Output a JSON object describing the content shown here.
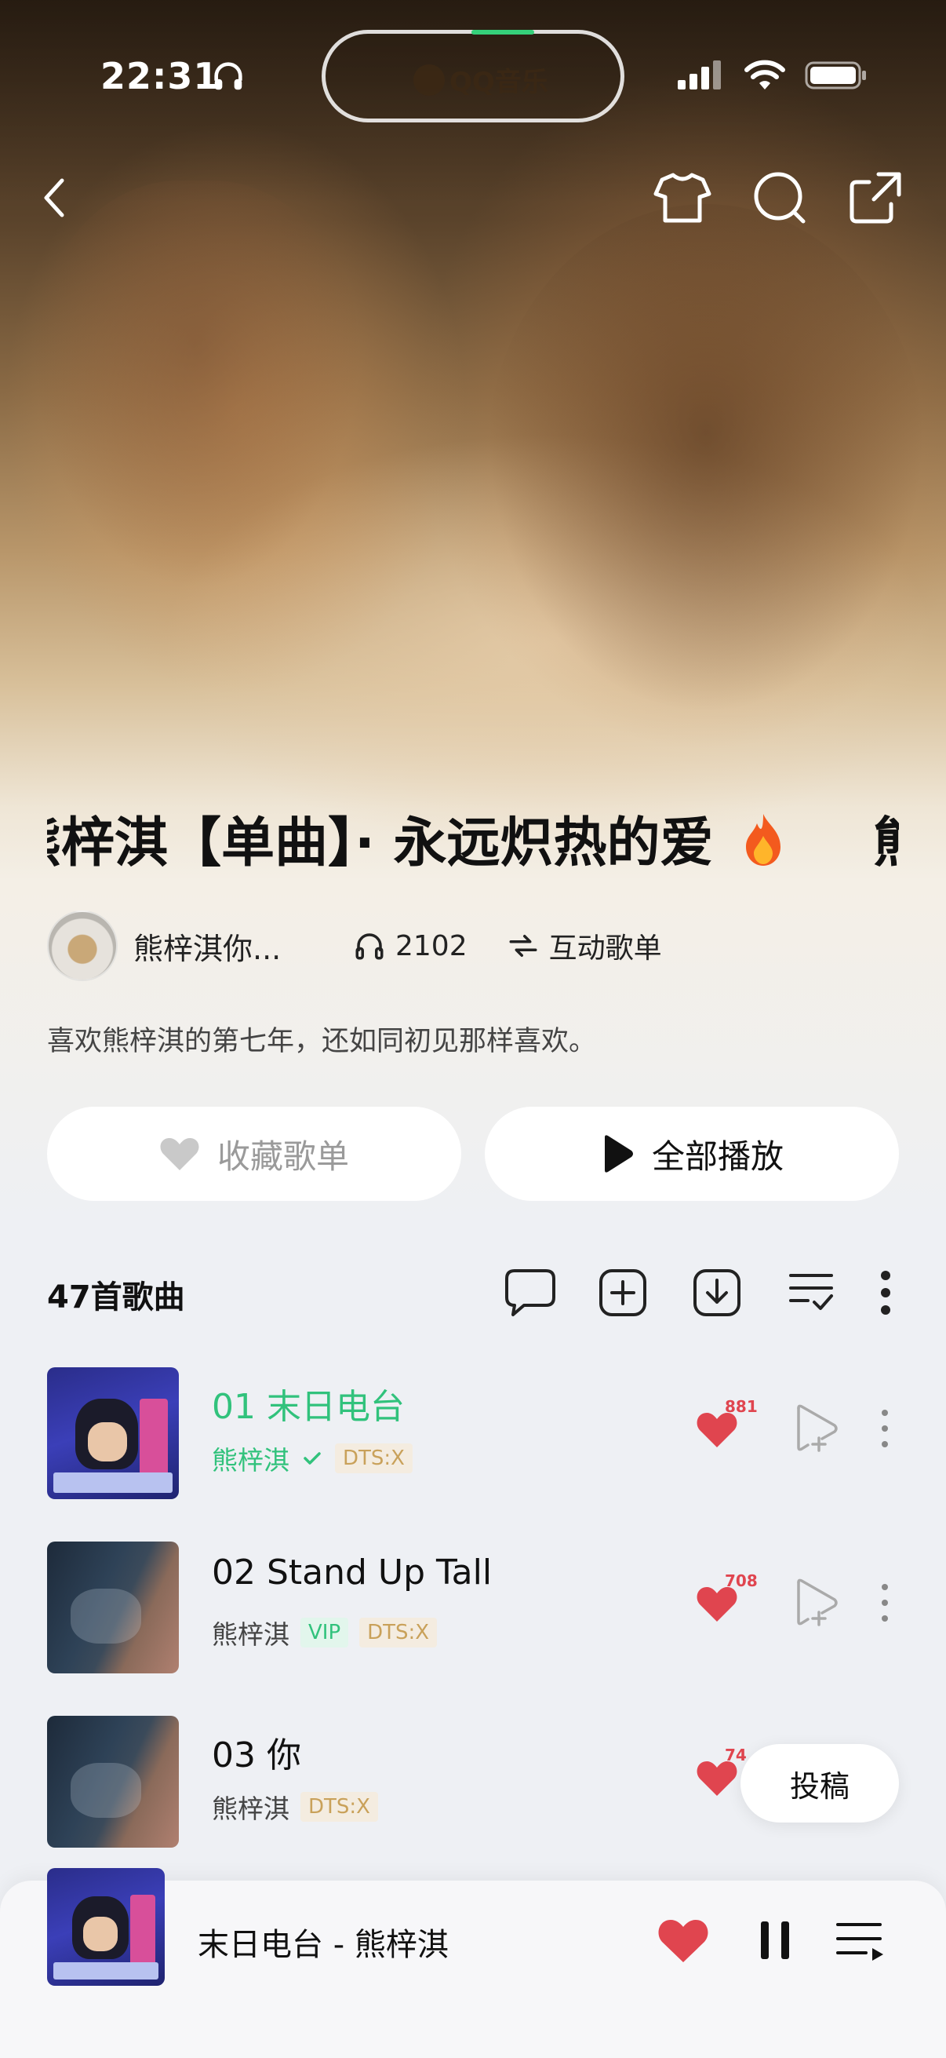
{
  "status_bar": {
    "time": "22:31",
    "island_label": "QQ音乐"
  },
  "header": {
    "icons": [
      "back-icon",
      "tshirt-icon",
      "search-icon",
      "share-icon"
    ]
  },
  "playlist": {
    "title": "熊梓淇【单曲】· 永远炽热的爱",
    "title_suffix": "熊",
    "creator_name": "熊梓淇你...",
    "listen_count": "2102",
    "interactive_label": "互动歌单",
    "description": "喜欢熊梓淇的第七年，还如同初见那样喜欢。"
  },
  "actions": {
    "favorite_label": "收藏歌单",
    "play_all_label": "全部播放"
  },
  "list": {
    "count_label": "47首歌曲"
  },
  "songs": [
    {
      "title": "01 末日电台",
      "artist": "熊梓淇",
      "tags": [
        "DTS:X"
      ],
      "likes": "881",
      "playing": true
    },
    {
      "title": "02 Stand Up Tall",
      "artist": "熊梓淇",
      "tags": [
        "VIP",
        "DTS:X"
      ],
      "likes": "708",
      "playing": false
    },
    {
      "title": "03 你",
      "artist": "熊梓淇",
      "tags": [
        "DTS:X"
      ],
      "likes": "74",
      "playing": false
    }
  ],
  "post_button": "投稿",
  "mini_player": {
    "title": "末日电台 - 熊梓淇"
  },
  "colors": {
    "accent": "#31c27c",
    "like": "#e0454f",
    "dts": "#c9a15a"
  }
}
